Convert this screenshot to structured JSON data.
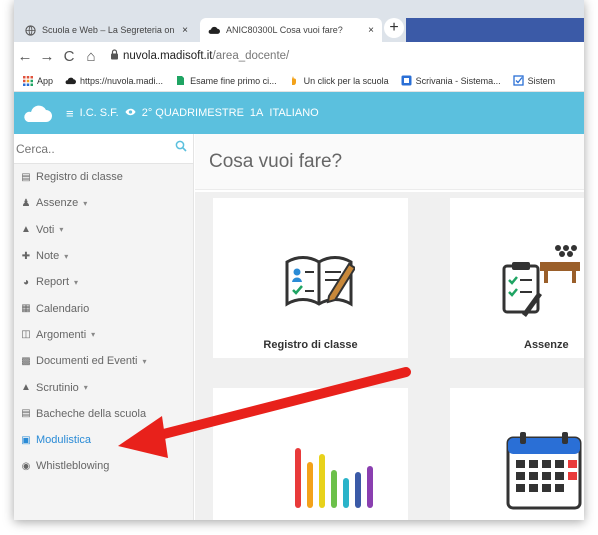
{
  "browser": {
    "tabs": [
      {
        "label": "Scuola e Web – La Segreteria on",
        "icon": "globe-icon",
        "close": "×"
      },
      {
        "label": "ANIC80300L Cosa vuoi fare?",
        "icon": "cloud-icon",
        "close": "×"
      }
    ],
    "new_tab": "+",
    "nav": {
      "back": "←",
      "forward": "→",
      "reload": "C",
      "home": "⌂"
    },
    "url_host": "nuvola.madisoft.it",
    "url_path": "/area_docente/",
    "bookmarks": [
      {
        "label": "App",
        "icon": "apps-grid-icon",
        "color": "#e0533d"
      },
      {
        "label": "https://nuvola.madi...",
        "icon": "cloud-icon",
        "color": "#222222"
      },
      {
        "label": "Esame fine primo ci...",
        "icon": "document-icon",
        "color": "#1fa463"
      },
      {
        "label": "Un click per la scuola",
        "icon": "hand-icon",
        "color": "#f3a21a"
      },
      {
        "label": "Scrivania - Sistema...",
        "icon": "desk-icon",
        "color": "#2a6fd6"
      },
      {
        "label": "Sistem",
        "icon": "checkbox-icon",
        "color": "#2a6fd6"
      }
    ]
  },
  "header": {
    "school": "I.C. S.F.",
    "period": "2° QUADRIMESTRE",
    "class": "1A",
    "subject": "ITALIANO",
    "bg_color": "#5bc0de"
  },
  "sidebar": {
    "search_placeholder": "Cerca..",
    "items": [
      {
        "label": "Registro di classe",
        "icon": "book-icon",
        "caret": ""
      },
      {
        "label": "Assenze",
        "icon": "user-icon",
        "caret": "▾"
      },
      {
        "label": "Voti",
        "icon": "bank-icon",
        "caret": "▾"
      },
      {
        "label": "Note",
        "icon": "pin-icon",
        "caret": "▾"
      },
      {
        "label": "Report",
        "icon": "pie-chart-icon",
        "caret": "▾"
      },
      {
        "label": "Calendario",
        "icon": "calendar-icon",
        "caret": ""
      },
      {
        "label": "Argomenti",
        "icon": "folder-open-icon",
        "caret": "▾"
      },
      {
        "label": "Documenti ed Eventi",
        "icon": "archive-icon",
        "caret": "▾"
      },
      {
        "label": "Scrutinio",
        "icon": "graduation-cap-icon",
        "caret": "▾"
      },
      {
        "label": "Bacheche della scuola",
        "icon": "board-icon",
        "caret": ""
      },
      {
        "label": "Modulistica",
        "icon": "briefcase-icon",
        "caret": "",
        "active": true
      },
      {
        "label": "Whistleblowing",
        "icon": "bell-icon",
        "caret": ""
      }
    ],
    "active_color": "#2a8bd6"
  },
  "main": {
    "title": "Cosa vuoi fare?",
    "cards": [
      {
        "label": "Registro di classe",
        "icon": "register-book-icon"
      },
      {
        "label": "Assenze",
        "icon": "attendance-clipboard-icon"
      },
      {
        "label": "",
        "icon": "bar-chart-icon"
      },
      {
        "label": "",
        "icon": "calendar-grid-icon"
      }
    ]
  },
  "annotation": {
    "color": "#e8211b"
  }
}
